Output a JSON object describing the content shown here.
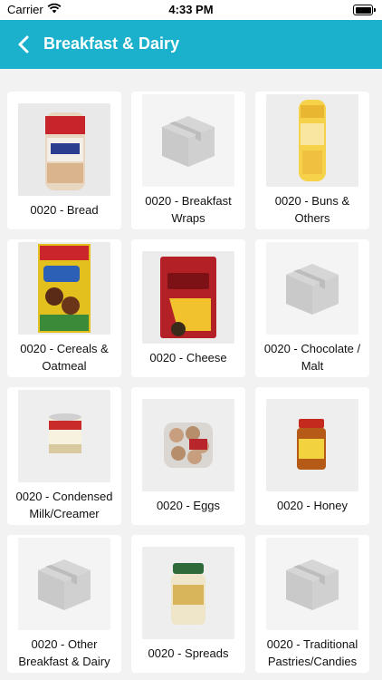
{
  "status_bar": {
    "carrier": "Carrier",
    "time": "4:33 PM"
  },
  "nav": {
    "title": "Breakfast & Dairy"
  },
  "categories": [
    {
      "label": "0020 - Bread",
      "image": "bread"
    },
    {
      "label": "0020 - Breakfast Wraps",
      "image": "placeholder-box"
    },
    {
      "label": "0020 - Buns & Others",
      "image": "butter-sugar-bun"
    },
    {
      "label": "0020 - Cereals & Oatmeal",
      "image": "cereal-box"
    },
    {
      "label": "0020 - Cheese",
      "image": "edam-cheese"
    },
    {
      "label": "0020 - Chocolate / Malt",
      "image": "placeholder-box"
    },
    {
      "label": "0020 - Condensed Milk/Creamer",
      "image": "condensed-milk-can"
    },
    {
      "label": "0020 - Eggs",
      "image": "egg-tray"
    },
    {
      "label": "0020 - Honey",
      "image": "honey-jar"
    },
    {
      "label": "0020 - Other Breakfast & Dairy",
      "image": "placeholder-box"
    },
    {
      "label": "0020 - Spreads",
      "image": "spread-jar"
    },
    {
      "label": "0020 - Traditional Pastries/Candies",
      "image": "placeholder-box"
    }
  ],
  "colors": {
    "header": "#1bb1cc",
    "background": "#f2f2f2",
    "placeholder_icon": "#d0d0d0"
  }
}
